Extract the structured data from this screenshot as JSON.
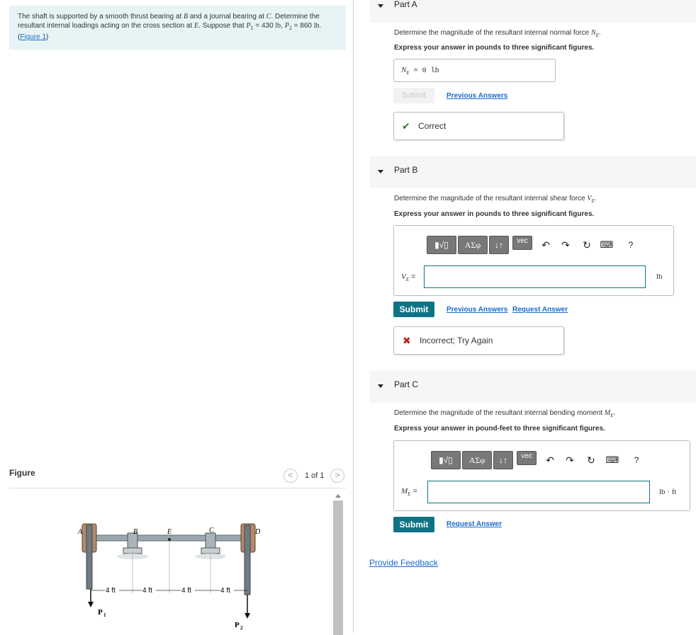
{
  "problem": {
    "text_1": "The shaft is supported by a smooth thrust bearing at ",
    "var_B": "B",
    "text_2": " and a journal bearing at ",
    "var_C": "C",
    "text_3": ". Determine the resultant internal loadings acting on the cross section at ",
    "var_E": "E",
    "text_4": ". Suppose that ",
    "p1_sym": "P",
    "p1_sub": "1",
    "text_5": " = 430 ",
    "unit_lb1": "lb",
    "text_6": ", ",
    "p2_sym": "P",
    "p2_sub": "2",
    "text_7": " = 860 ",
    "unit_lb2": "lb",
    "text_8": ". (",
    "figure_link": "Figure 1",
    "text_9": ")"
  },
  "figure": {
    "heading": "Figure",
    "counter": "1 of 1",
    "prev": "<",
    "next": ">",
    "labels": {
      "A": "A",
      "B": "B",
      "E": "E",
      "C": "C",
      "D": "D",
      "P1": "P",
      "P1_sub": "1",
      "P2": "P",
      "P2_sub": "2"
    },
    "dims": [
      "4 ft",
      "4 ft",
      "4 ft",
      "4 ft"
    ]
  },
  "partA": {
    "label": "Part A",
    "prompt_text": "Determine the magnitude of the resultant internal normal force ",
    "prompt_var": "N",
    "prompt_sub": "E",
    "instruction": "Express your answer in pounds to three significant figures.",
    "answer_var": "N",
    "answer_sub": "E",
    "answer_value": " = 0 lb",
    "submit": "Submit",
    "previous_answers": "Previous Answers",
    "feedback": "Correct",
    "feedback_icon": "✔"
  },
  "partB": {
    "label": "Part B",
    "prompt_text": "Determine the magnitude of the resultant internal shear force ",
    "prompt_var": "V",
    "prompt_sub": "E",
    "instruction": "Express your answer in pounds to three significant figures.",
    "var": "V",
    "var_sub": "E",
    "eq": " =",
    "unit": "lb",
    "submit": "Submit",
    "previous_answers": "Previous Answers",
    "request_answer": "Request Answer",
    "feedback": "Incorrect; Try Again",
    "feedback_icon": "✖"
  },
  "partC": {
    "label": "Part C",
    "prompt_text": "Determine the magnitude of the resultant internal bending moment ",
    "prompt_var": "M",
    "prompt_sub": "E",
    "instruction": "Express your answer in pound-feet to three significant figures.",
    "var": "M",
    "var_sub": "E",
    "eq": " =",
    "unit": "lb · ft",
    "submit": "Submit",
    "request_answer": "Request Answer"
  },
  "toolbar": {
    "templates": "▮√▯",
    "greek": "ΑΣφ",
    "arrows": "↓↑",
    "vec": "vec",
    "undo": "↶",
    "redo": "↷",
    "reset": "↻",
    "keyboard": "⌨",
    "help": "?"
  },
  "provide_feedback": "Provide Feedback",
  "colors": {
    "teal": "#0f7386",
    "link": "#1b6ac9",
    "correct": "#2e7d1a",
    "incorrect": "#c0231b",
    "problem_bg": "#e6f4f5"
  }
}
